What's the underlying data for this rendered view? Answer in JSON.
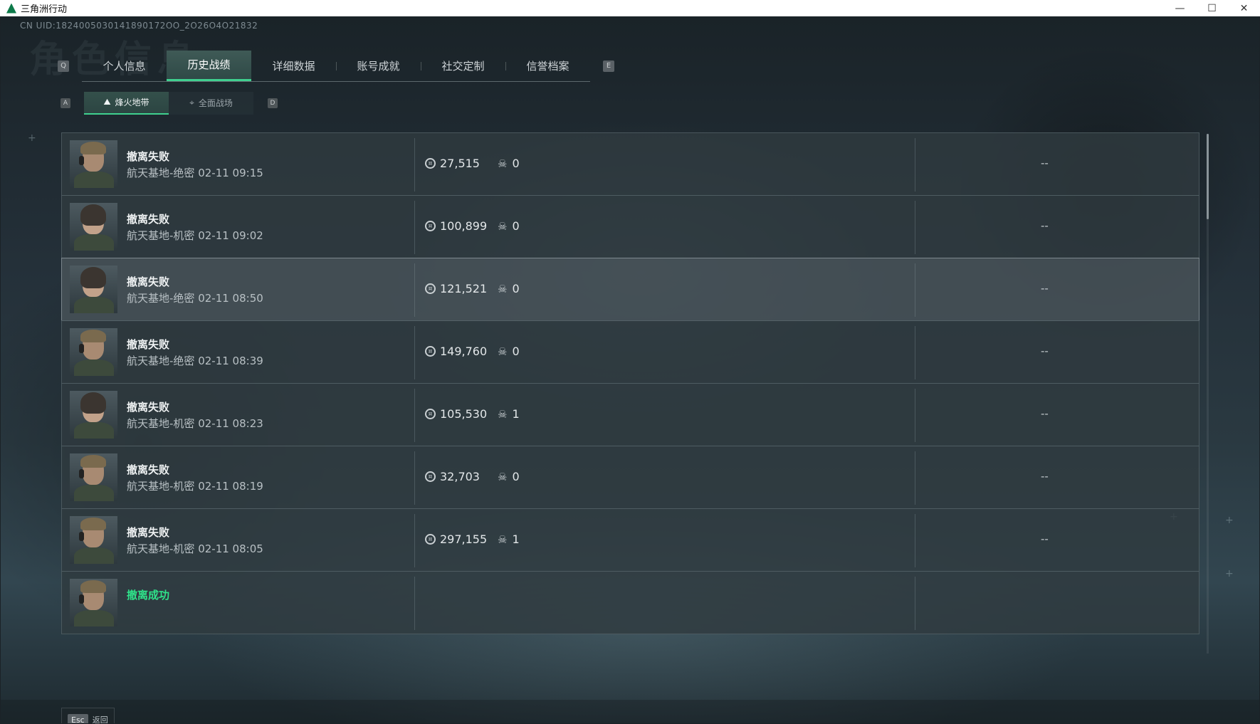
{
  "window": {
    "title": "三角洲行动",
    "controls": {
      "minimize": "—",
      "maximize": "☐",
      "close": "✕"
    }
  },
  "header": {
    "uid_text": "CN UID:1824005030141890172OO_2O26O4O21832",
    "watermark": "角色信息"
  },
  "tabs": {
    "left_key": "Q",
    "right_key": "E",
    "items": [
      {
        "label": "个人信息"
      },
      {
        "label": "历史战绩"
      },
      {
        "label": "详细数据"
      },
      {
        "label": "账号成就"
      },
      {
        "label": "社交定制"
      },
      {
        "label": "信誉档案"
      }
    ],
    "active_index": 1
  },
  "subtabs": {
    "left_key": "A",
    "right_key": "D",
    "items": [
      {
        "label": "烽火地带",
        "icon": "mountain-icon"
      },
      {
        "label": "全面战场",
        "icon": "crosshair-icon"
      }
    ],
    "active_index": 0
  },
  "matches": [
    {
      "result": "撤离失败",
      "status": "fail",
      "map": "航天基地-绝密",
      "time": "02-11 09:15",
      "value": "27,515",
      "kills": "0",
      "extra": "--",
      "avatar": "male"
    },
    {
      "result": "撤离失败",
      "status": "fail",
      "map": "航天基地-机密",
      "time": "02-11 09:02",
      "value": "100,899",
      "kills": "0",
      "extra": "--",
      "avatar": "female"
    },
    {
      "result": "撤离失败",
      "status": "fail",
      "map": "航天基地-绝密",
      "time": "02-11 08:50",
      "value": "121,521",
      "kills": "0",
      "extra": "--",
      "avatar": "female"
    },
    {
      "result": "撤离失败",
      "status": "fail",
      "map": "航天基地-绝密",
      "time": "02-11 08:39",
      "value": "149,760",
      "kills": "0",
      "extra": "--",
      "avatar": "male"
    },
    {
      "result": "撤离失败",
      "status": "fail",
      "map": "航天基地-机密",
      "time": "02-11 08:23",
      "value": "105,530",
      "kills": "1",
      "extra": "--",
      "avatar": "female"
    },
    {
      "result": "撤离失败",
      "status": "fail",
      "map": "航天基地-机密",
      "time": "02-11 08:19",
      "value": "32,703",
      "kills": "0",
      "extra": "--",
      "avatar": "male"
    },
    {
      "result": "撤离失败",
      "status": "fail",
      "map": "航天基地-机密",
      "time": "02-11 08:05",
      "value": "297,155",
      "kills": "1",
      "extra": "--",
      "avatar": "male"
    },
    {
      "result": "撤离成功",
      "status": "success",
      "map": "",
      "time": "",
      "value": "",
      "kills": "",
      "extra": "",
      "avatar": "male"
    }
  ],
  "highlighted_row": 2,
  "footer": {
    "esc_key": "Esc",
    "back_label": "返回"
  },
  "colors": {
    "accent": "#3fd08f",
    "success": "#2fe28a"
  }
}
